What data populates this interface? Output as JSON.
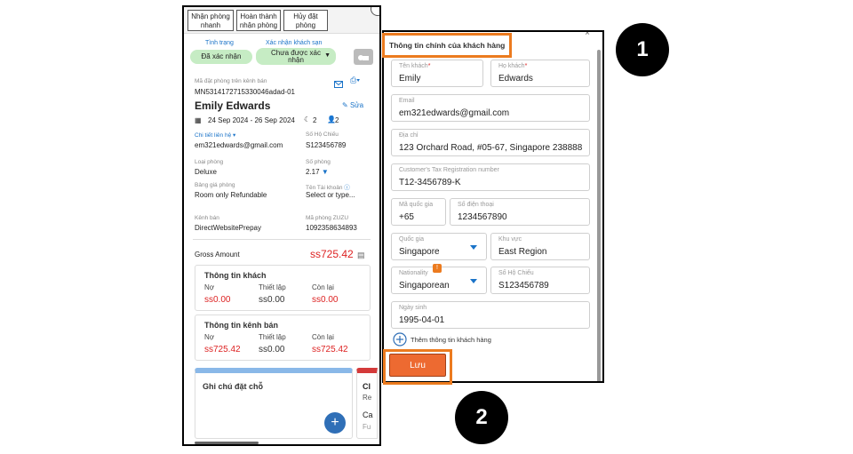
{
  "top_buttons": [
    {
      "label_1": "Nhận phòng",
      "label_2": "nhanh"
    },
    {
      "label_1": "Hoàn thành",
      "label_2": "nhận phòng"
    },
    {
      "label_1": "Hủy đặt",
      "label_2": "phòng"
    }
  ],
  "status": {
    "status_label": "Tình trạng",
    "status_value": "Đã xác nhận",
    "confirm_label": "Xác nhận khách sạn",
    "confirm_value_1": "Chưa được xác",
    "confirm_value_2": "nhận"
  },
  "booking": {
    "channel_code_label": "Mã đặt phòng trên kênh bán",
    "channel_code": "MN5314172715330046adad-01",
    "guest_name": "Emily Edwards",
    "edit_label": "Sửa",
    "dates": "24 Sep 2024 - 26 Sep 2024",
    "nights": "2",
    "guests": "2",
    "contact_label": "Chi tiết liên hệ",
    "contact_value": "em321edwards@gmail.com",
    "passport_label": "Số Hộ Chiếu",
    "passport_value": "S123456789",
    "room_type_label": "Loại phòng",
    "room_type_value": "Deluxe",
    "room_no_label": "Số phòng",
    "room_no_value": "2.17",
    "rate_label": "Bảng giá phòng",
    "rate_value": "Room only Refundable",
    "account_label": "Tên Tài khoản",
    "account_value": "Select or type...",
    "channel_label": "Kênh bán",
    "channel_value": "DirectWebsitePrepay",
    "zuzu_label": "Mã phòng ZUZU",
    "zuzu_value": "1092358634893",
    "gross_label": "Gross Amount",
    "gross_value": "ss725.42"
  },
  "guest_card": {
    "title": "Thông tin khách",
    "col1": "Nợ",
    "col2": "Thiết lập",
    "col3": "Còn lại",
    "val1": "ss0.00",
    "val2": "ss0.00",
    "val3": "ss0.00"
  },
  "channel_card": {
    "title": "Thông tin kênh bán",
    "col1": "Nợ",
    "col2": "Thiết lập",
    "col3": "Còn lại",
    "val1": "ss725.42",
    "val2": "ss0.00",
    "val3": "ss725.42"
  },
  "notes": {
    "title": "Ghi chú đặt chỗ",
    "plus": "+",
    "side_1": "Cl",
    "side_2": "Re",
    "side_3": "Ca",
    "side_4": "Fu"
  },
  "form": {
    "title": "Thông tin chính của khách hàng",
    "first_name_label": "Tên khách",
    "first_name": "Emily",
    "last_name_label": "Họ khách",
    "last_name": "Edwards",
    "email_label": "Email",
    "email": "em321edwards@gmail.com",
    "address_label": "Địa chỉ",
    "address": "123 Orchard Road, #05-67, Singapore 238888",
    "tax_label": "Customer's Tax Registration number",
    "tax": "T12-3456789-K",
    "country_code_label": "Mã quốc gia",
    "country_code": "+65",
    "phone_label": "Số điện thoại",
    "phone": "1234567890",
    "country_label": "Quốc gia",
    "country": "Singapore",
    "region_label": "Khu vực",
    "region": "East Region",
    "nationality_label": "Nationality",
    "nationality": "Singaporean",
    "passport_label": "Số Hộ Chiếu",
    "passport": "S123456789",
    "dob_label": "Ngày sinh",
    "dob": "1995-04-01",
    "add_more": "Thêm thông tin khách hàng",
    "save": "Lưu",
    "required_mark": "*",
    "info_mark": "!"
  },
  "callouts": {
    "one": "1",
    "two": "2"
  },
  "colors": {
    "accent_orange": "#ec7b1f",
    "save_button": "#ed6a31",
    "link_blue": "#1a73c8",
    "amount_red": "#dd2222",
    "pill_green": "#c6ecc4"
  }
}
